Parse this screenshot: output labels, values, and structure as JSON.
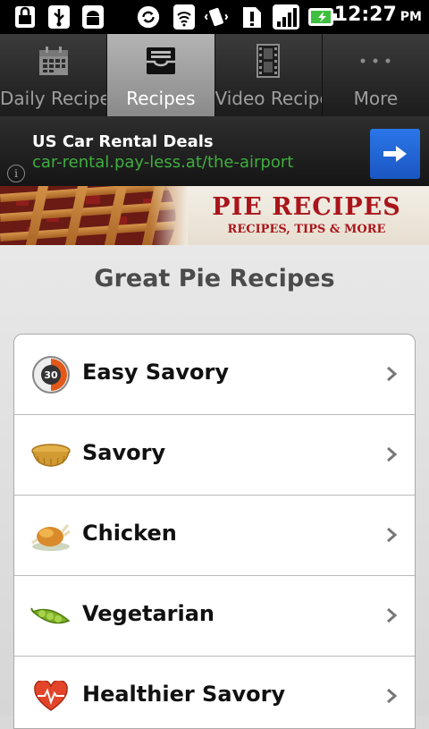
{
  "status_bar": {
    "time": "12:27",
    "ampm": "PM",
    "icons": [
      "lock-icon",
      "usb-icon",
      "android-icon",
      "sync-icon",
      "wifi-icon",
      "vibrate-icon",
      "sim-alert-icon",
      "signal-icon",
      "battery-charging-icon"
    ]
  },
  "tabs": [
    {
      "label": "Daily Recipes",
      "icon": "calendar-icon",
      "selected": false
    },
    {
      "label": "Recipes",
      "icon": "inbox-tray-icon",
      "selected": true
    },
    {
      "label": "Video Recipe",
      "icon": "film-icon",
      "selected": false
    },
    {
      "label": "More",
      "icon": "more-dots-icon",
      "selected": false
    }
  ],
  "ad": {
    "title": "US Car Rental Deals",
    "url": "car-rental.pay-less.at/the-airport",
    "info_glyph": "i",
    "accent_color": "#3fae3f"
  },
  "banner": {
    "title": "PIE RECIPES",
    "subtitle": "RECIPES, TIPS & MORE",
    "title_color": "#a9151b"
  },
  "page": {
    "title": "Great Pie Recipes"
  },
  "categories": [
    {
      "label": "Easy Savory",
      "icon": "timer-30-icon"
    },
    {
      "label": "Savory",
      "icon": "pie-dish-icon"
    },
    {
      "label": "Chicken",
      "icon": "roast-chicken-icon"
    },
    {
      "label": "Vegetarian",
      "icon": "pea-pod-icon"
    },
    {
      "label": "Healthier Savory",
      "icon": "heart-pulse-icon"
    }
  ]
}
